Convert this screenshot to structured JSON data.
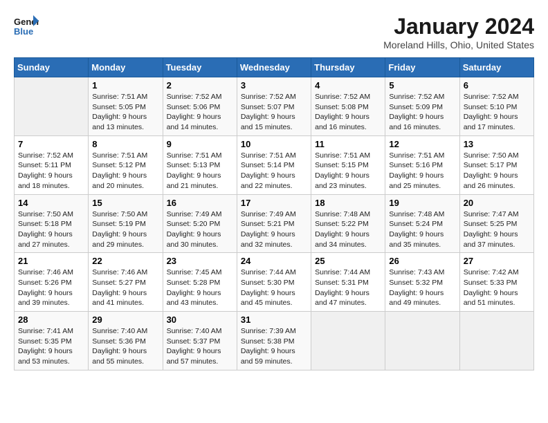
{
  "header": {
    "logo_line1": "General",
    "logo_line2": "Blue",
    "title": "January 2024",
    "subtitle": "Moreland Hills, Ohio, United States"
  },
  "days_of_week": [
    "Sunday",
    "Monday",
    "Tuesday",
    "Wednesday",
    "Thursday",
    "Friday",
    "Saturday"
  ],
  "weeks": [
    [
      {
        "day": "",
        "info": ""
      },
      {
        "day": "1",
        "info": "Sunrise: 7:51 AM\nSunset: 5:05 PM\nDaylight: 9 hours\nand 13 minutes."
      },
      {
        "day": "2",
        "info": "Sunrise: 7:52 AM\nSunset: 5:06 PM\nDaylight: 9 hours\nand 14 minutes."
      },
      {
        "day": "3",
        "info": "Sunrise: 7:52 AM\nSunset: 5:07 PM\nDaylight: 9 hours\nand 15 minutes."
      },
      {
        "day": "4",
        "info": "Sunrise: 7:52 AM\nSunset: 5:08 PM\nDaylight: 9 hours\nand 16 minutes."
      },
      {
        "day": "5",
        "info": "Sunrise: 7:52 AM\nSunset: 5:09 PM\nDaylight: 9 hours\nand 16 minutes."
      },
      {
        "day": "6",
        "info": "Sunrise: 7:52 AM\nSunset: 5:10 PM\nDaylight: 9 hours\nand 17 minutes."
      }
    ],
    [
      {
        "day": "7",
        "info": "Sunrise: 7:52 AM\nSunset: 5:11 PM\nDaylight: 9 hours\nand 18 minutes."
      },
      {
        "day": "8",
        "info": "Sunrise: 7:51 AM\nSunset: 5:12 PM\nDaylight: 9 hours\nand 20 minutes."
      },
      {
        "day": "9",
        "info": "Sunrise: 7:51 AM\nSunset: 5:13 PM\nDaylight: 9 hours\nand 21 minutes."
      },
      {
        "day": "10",
        "info": "Sunrise: 7:51 AM\nSunset: 5:14 PM\nDaylight: 9 hours\nand 22 minutes."
      },
      {
        "day": "11",
        "info": "Sunrise: 7:51 AM\nSunset: 5:15 PM\nDaylight: 9 hours\nand 23 minutes."
      },
      {
        "day": "12",
        "info": "Sunrise: 7:51 AM\nSunset: 5:16 PM\nDaylight: 9 hours\nand 25 minutes."
      },
      {
        "day": "13",
        "info": "Sunrise: 7:50 AM\nSunset: 5:17 PM\nDaylight: 9 hours\nand 26 minutes."
      }
    ],
    [
      {
        "day": "14",
        "info": "Sunrise: 7:50 AM\nSunset: 5:18 PM\nDaylight: 9 hours\nand 27 minutes."
      },
      {
        "day": "15",
        "info": "Sunrise: 7:50 AM\nSunset: 5:19 PM\nDaylight: 9 hours\nand 29 minutes."
      },
      {
        "day": "16",
        "info": "Sunrise: 7:49 AM\nSunset: 5:20 PM\nDaylight: 9 hours\nand 30 minutes."
      },
      {
        "day": "17",
        "info": "Sunrise: 7:49 AM\nSunset: 5:21 PM\nDaylight: 9 hours\nand 32 minutes."
      },
      {
        "day": "18",
        "info": "Sunrise: 7:48 AM\nSunset: 5:22 PM\nDaylight: 9 hours\nand 34 minutes."
      },
      {
        "day": "19",
        "info": "Sunrise: 7:48 AM\nSunset: 5:24 PM\nDaylight: 9 hours\nand 35 minutes."
      },
      {
        "day": "20",
        "info": "Sunrise: 7:47 AM\nSunset: 5:25 PM\nDaylight: 9 hours\nand 37 minutes."
      }
    ],
    [
      {
        "day": "21",
        "info": "Sunrise: 7:46 AM\nSunset: 5:26 PM\nDaylight: 9 hours\nand 39 minutes."
      },
      {
        "day": "22",
        "info": "Sunrise: 7:46 AM\nSunset: 5:27 PM\nDaylight: 9 hours\nand 41 minutes."
      },
      {
        "day": "23",
        "info": "Sunrise: 7:45 AM\nSunset: 5:28 PM\nDaylight: 9 hours\nand 43 minutes."
      },
      {
        "day": "24",
        "info": "Sunrise: 7:44 AM\nSunset: 5:30 PM\nDaylight: 9 hours\nand 45 minutes."
      },
      {
        "day": "25",
        "info": "Sunrise: 7:44 AM\nSunset: 5:31 PM\nDaylight: 9 hours\nand 47 minutes."
      },
      {
        "day": "26",
        "info": "Sunrise: 7:43 AM\nSunset: 5:32 PM\nDaylight: 9 hours\nand 49 minutes."
      },
      {
        "day": "27",
        "info": "Sunrise: 7:42 AM\nSunset: 5:33 PM\nDaylight: 9 hours\nand 51 minutes."
      }
    ],
    [
      {
        "day": "28",
        "info": "Sunrise: 7:41 AM\nSunset: 5:35 PM\nDaylight: 9 hours\nand 53 minutes."
      },
      {
        "day": "29",
        "info": "Sunrise: 7:40 AM\nSunset: 5:36 PM\nDaylight: 9 hours\nand 55 minutes."
      },
      {
        "day": "30",
        "info": "Sunrise: 7:40 AM\nSunset: 5:37 PM\nDaylight: 9 hours\nand 57 minutes."
      },
      {
        "day": "31",
        "info": "Sunrise: 7:39 AM\nSunset: 5:38 PM\nDaylight: 9 hours\nand 59 minutes."
      },
      {
        "day": "",
        "info": ""
      },
      {
        "day": "",
        "info": ""
      },
      {
        "day": "",
        "info": ""
      }
    ]
  ]
}
